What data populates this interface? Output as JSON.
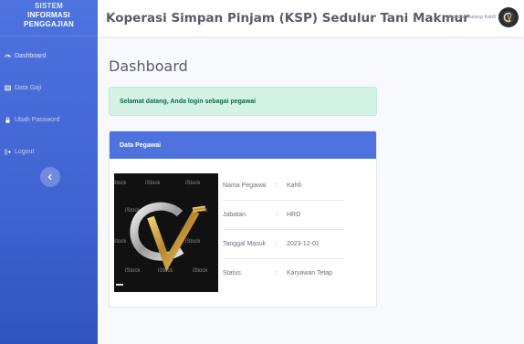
{
  "sidebar": {
    "brand_line1": "SISTEM",
    "brand_line2": "INFORMASI",
    "brand_line3": "PENGGAJIAN",
    "items": [
      {
        "label": "Dashboard",
        "icon": "gauge-icon"
      },
      {
        "label": "Data Gaji",
        "icon": "table-icon"
      },
      {
        "label": "Ubah Password",
        "icon": "lock-icon"
      },
      {
        "label": "Logout",
        "icon": "logout-icon"
      }
    ],
    "toggle_icon": "chevron-left-icon"
  },
  "topbar": {
    "title": "Koperasi Simpan Pinjam (KSP) Sedulur Tani Makmur",
    "welcome": "Selamat Datang Kahfi"
  },
  "main": {
    "page_title": "Dashboard",
    "alert": "Selamat datang, Anda login sebagai pegawai",
    "card_title": "Data Pegawai",
    "photo_text": "CV",
    "watermark": "iStock",
    "employee": [
      {
        "label": "Nama Pegawai",
        "sep": ":",
        "value": "Kahfi"
      },
      {
        "label": "Jabatan",
        "sep": ":",
        "value": "HRD"
      },
      {
        "label": "Tanggal Masuk",
        "sep": ":",
        "value": "2023-12-01"
      },
      {
        "label": "Status",
        "sep": ":",
        "value": "Karyawan Tetap"
      }
    ]
  },
  "colors": {
    "primary": "#4e73df",
    "alert_bg": "#d4f3e7",
    "alert_text": "#0f6848"
  }
}
